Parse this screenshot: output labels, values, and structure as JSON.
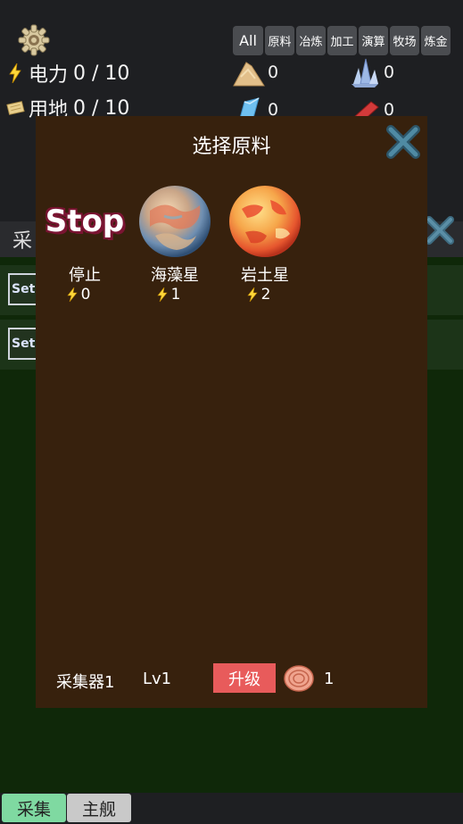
{
  "hud": {
    "settings_icon": "gear-icon",
    "power": {
      "icon": "lightning-icon",
      "label": "电力",
      "value": "0 / 10"
    },
    "land": {
      "icon": "land-map-icon",
      "label": "用地",
      "value": "0 / 10"
    }
  },
  "filters": [
    "All",
    "原料",
    "冶炼",
    "加工",
    "演算",
    "牧场",
    "炼金"
  ],
  "resources": [
    {
      "icon": "sand-pile-icon",
      "count": "0"
    },
    {
      "icon": "crystal-cluster-icon",
      "count": "0"
    },
    {
      "icon": "blue-gem-icon",
      "count": "0"
    },
    {
      "icon": "red-block-icon",
      "count": "0"
    }
  ],
  "background_panel": {
    "header_label": "采",
    "rows": [
      {
        "button_label": "Set"
      },
      {
        "button_label": "Set"
      }
    ]
  },
  "modal": {
    "title": "选择原料",
    "options": [
      {
        "name": "停止",
        "cost": "0",
        "image": "stop-label",
        "image_text": "Stop"
      },
      {
        "name": "海藻星",
        "cost": "1",
        "image": "seaweed-planet-icon"
      },
      {
        "name": "岩土星",
        "cost": "2",
        "image": "rock-planet-icon"
      }
    ],
    "collector_name": "采集器1",
    "level": "Lv1",
    "upgrade_label": "升级",
    "upgrade_cost_icon": "copper-coil-icon",
    "upgrade_cost": "1"
  },
  "tabs": [
    {
      "label": "采集",
      "active": true
    },
    {
      "label": "主舰",
      "active": false
    }
  ],
  "colors": {
    "modal_bg": "#37210d",
    "upgrade_btn": "#e85b5b",
    "active_tab": "#7fd9a1",
    "panel_bg": "#0f2809",
    "close_icon": "#3e6b80"
  }
}
